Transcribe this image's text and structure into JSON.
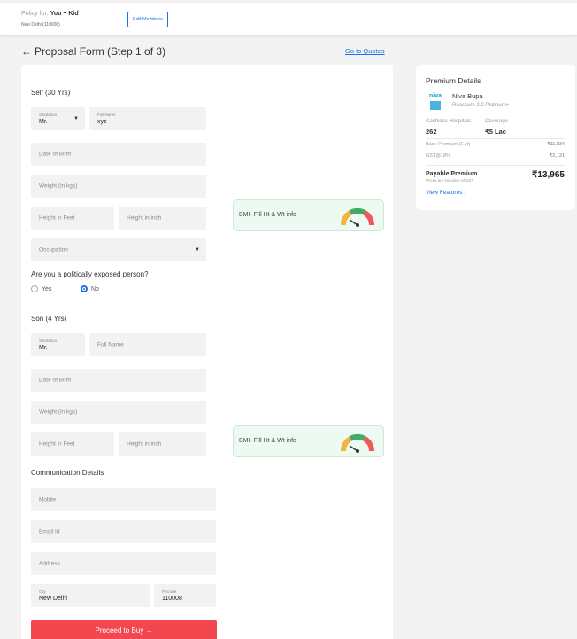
{
  "header": {
    "policy_prefix": "Policy for: ",
    "policy_for": "You + Kid",
    "location": "New Delhi (110008)",
    "edit_members": "Edit Members"
  },
  "page": {
    "back_arrow": "←",
    "title": "Proposal Form (Step 1 of 3)",
    "goto_quotes": "Go to Quotes"
  },
  "self_section": {
    "title": "Self (30 Yrs)",
    "salutation_label": "Salutation",
    "salutation_value": "Mr.",
    "fullname_label": "Full Name",
    "fullname_value": "xyz",
    "dob_placeholder": "Date of Birth",
    "weight_placeholder": "Weight (in kgs)",
    "height_feet_placeholder": "Height in Feet",
    "height_inch_placeholder": "Height in inch",
    "occupation_placeholder": "Occupation",
    "bmi_info": "BMI- Fill Ht & Wt info"
  },
  "pep": {
    "question": "Are you a politically exposed person?",
    "yes": "Yes",
    "no": "No",
    "selected": "No"
  },
  "son_section": {
    "title": "Son (4 Yrs)",
    "salutation_label": "Salutation",
    "salutation_value": "Mr.",
    "fullname_placeholder": "Full Name",
    "dob_placeholder": "Date of Birth",
    "weight_placeholder": "Weight (in kgs)",
    "height_feet_placeholder": "Height in Feet",
    "height_inch_placeholder": "Height in inch",
    "bmi_info": "BMI- Fill Ht & Wt info"
  },
  "communication": {
    "title": "Communication Details",
    "mobile_placeholder": "Mobile",
    "email_placeholder": "Email Id",
    "address_placeholder": "Address",
    "city_label": "City",
    "city_value": "New Delhi",
    "pincode_label": "Pincode",
    "pincode_value": "110008"
  },
  "proceed_button": "Proceed to Buy →",
  "premium": {
    "title": "Premium Details",
    "logo_word": "niva",
    "insurer": "Niva Bupa",
    "plan": "Reassure 2.0 Platinum+",
    "cashless_label": "Cashless Hospitals",
    "cashless_value": "262",
    "coverage_label": "Coverage",
    "coverage_value": "₹5 Lac",
    "base_label": "Base Premium (1 yr)",
    "base_value": "₹11,834",
    "gst_label": "GST@18%",
    "gst_value": "₹2,131",
    "payable_label": "Payable Premium",
    "payable_note": "Prices are inclusive of GST",
    "payable_value": "₹13,965",
    "view_features": "View Features ›"
  },
  "colors": {
    "accent": "#1a73e8",
    "cta": "#f2474f",
    "bmi_bg": "#edfaf2"
  }
}
